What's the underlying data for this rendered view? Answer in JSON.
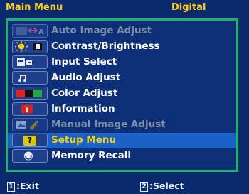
{
  "header": {
    "title": "Main Menu",
    "mode": "Digital"
  },
  "menu": {
    "items": [
      {
        "label": "Auto Image Adjust",
        "icon": "auto-image-adjust-icon",
        "state": "disabled"
      },
      {
        "label": "Contrast/Brightness",
        "icon": "contrast-brightness-icon",
        "state": "normal"
      },
      {
        "label": "Input Select",
        "icon": "input-select-icon",
        "state": "normal"
      },
      {
        "label": "Audio Adjust",
        "icon": "audio-icon",
        "state": "normal"
      },
      {
        "label": "Color Adjust",
        "icon": "color-adjust-icon",
        "state": "normal"
      },
      {
        "label": "Information",
        "icon": "information-icon",
        "state": "normal"
      },
      {
        "label": "Manual Image Adjust",
        "icon": "manual-image-adjust-icon",
        "state": "disabled"
      },
      {
        "label": "Setup Menu",
        "icon": "setup-menu-icon",
        "state": "selected"
      },
      {
        "label": "Memory Recall",
        "icon": "memory-recall-icon",
        "state": "normal"
      }
    ]
  },
  "footer": {
    "left_key": "1",
    "left_label": ":Exit",
    "right_key": "2",
    "right_label": ":Select"
  },
  "colors": {
    "background": "#0b2a6e",
    "frame": "#1fb06a",
    "header_text": "#ffd21a",
    "selected_bg": "#1a62c8",
    "selected_text": "#f5d000",
    "disabled_text": "#7e8ea5"
  }
}
